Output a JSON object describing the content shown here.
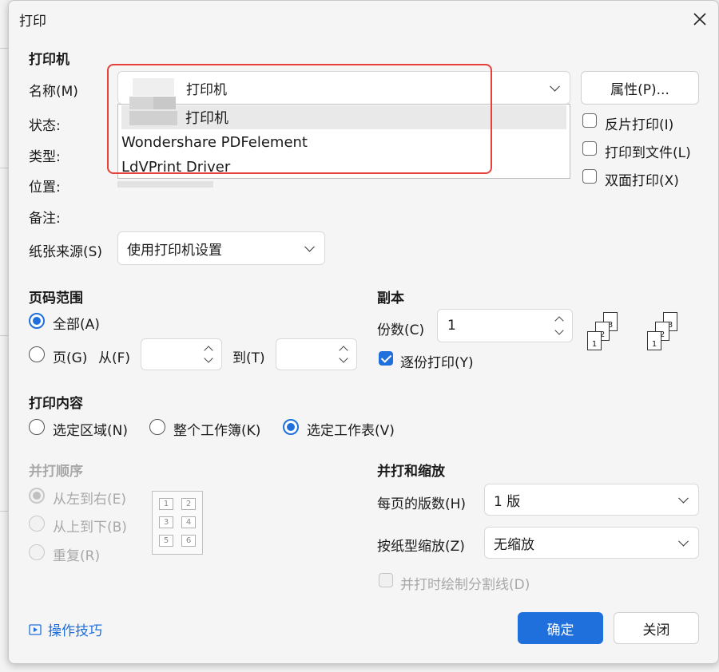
{
  "window": {
    "title": "打印",
    "close_icon": "close-icon"
  },
  "printer": {
    "section": "打印机",
    "name_label": "名称(M)",
    "selected_name": "打印机",
    "properties_button": "属性(P)...",
    "status_label": "状态:",
    "type_label": "类型:",
    "location_label": "位置:",
    "comment_label": "备注:",
    "paper_source_label": "纸张来源(S)",
    "paper_source_value": "使用打印机设置",
    "dropdown_items": [
      "打印机",
      "Wondershare PDFelement",
      "LdVPrint Driver"
    ],
    "reverse_print": "反片打印(I)",
    "print_to_file": "打印到文件(L)",
    "duplex": "双面打印(X)"
  },
  "page_range": {
    "section": "页码范围",
    "all": "全部(A)",
    "pages": "页(G)",
    "from": "从(F)",
    "to": "到(T)"
  },
  "copies": {
    "section": "副本",
    "count_label": "份数(C)",
    "count_value": "1",
    "collate": "逐份打印(Y)",
    "collate_icon": "collate-pages-icon"
  },
  "print_content": {
    "section": "打印内容",
    "selection": "选定区域(N)",
    "workbook": "整个工作簿(K)",
    "worksheet": "选定工作表(V)"
  },
  "order": {
    "section": "并打顺序",
    "left_to_right": "从左到右(E)",
    "top_to_bottom": "从上到下(B)",
    "repeat": "重复(R)",
    "cells": [
      "1",
      "2",
      "3",
      "4",
      "5",
      "6"
    ]
  },
  "scaling": {
    "section": "并打和缩放",
    "pages_per_sheet_label": "每页的版数(H)",
    "pages_per_sheet_value": "1 版",
    "scale_label": "按纸型缩放(Z)",
    "scale_value": "无缩放",
    "draw_lines": "并打时绘制分割线(D)"
  },
  "footer": {
    "tips": "操作技巧",
    "ok": "确定",
    "cancel": "关闭"
  },
  "copies_icon_pages": [
    "1",
    "2",
    "3"
  ]
}
